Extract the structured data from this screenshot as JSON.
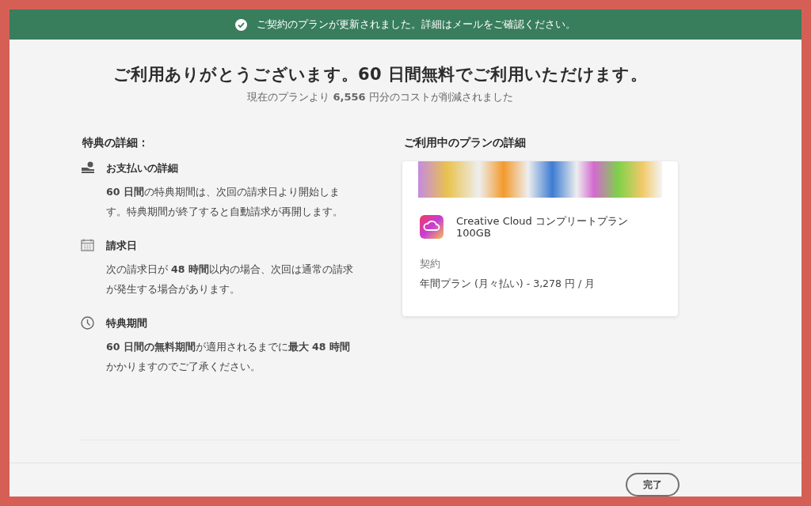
{
  "notification": {
    "text": "ご契約のプランが更新されました。詳細はメールをご確認ください。"
  },
  "heading": "ご利用ありがとうございます。60 日間無料でご利用いただけます。",
  "subheading": "現在のプランより **6,556** 円分のコストが削減されました",
  "benefits": {
    "title": "特典の詳細：",
    "items": [
      {
        "kind": "payment",
        "title": "お支払いの詳細",
        "text": "**60 日間**の特典期間は、次回の請求日より開始します。特典期間が終了すると自動請求が再開します。"
      },
      {
        "kind": "calendar",
        "title": "請求日",
        "text": "次の請求日が **48 時間**以内の場合、次回は通常の請求が発生する場合があります。"
      },
      {
        "kind": "clock",
        "title": "特典期間",
        "text": "**60 日間の無料期間**が適用されるまでに**最大 48 時間**かかりますのでご了承ください。"
      }
    ]
  },
  "plan": {
    "title": "ご利用中のプランの詳細",
    "name": "Creative Cloud コンプリートプラン 100GB",
    "contract_label": "契約",
    "contract_value": "年間プラン (月々払い) - 3,278 円 / 月"
  },
  "buttons": [
    "完了"
  ]
}
